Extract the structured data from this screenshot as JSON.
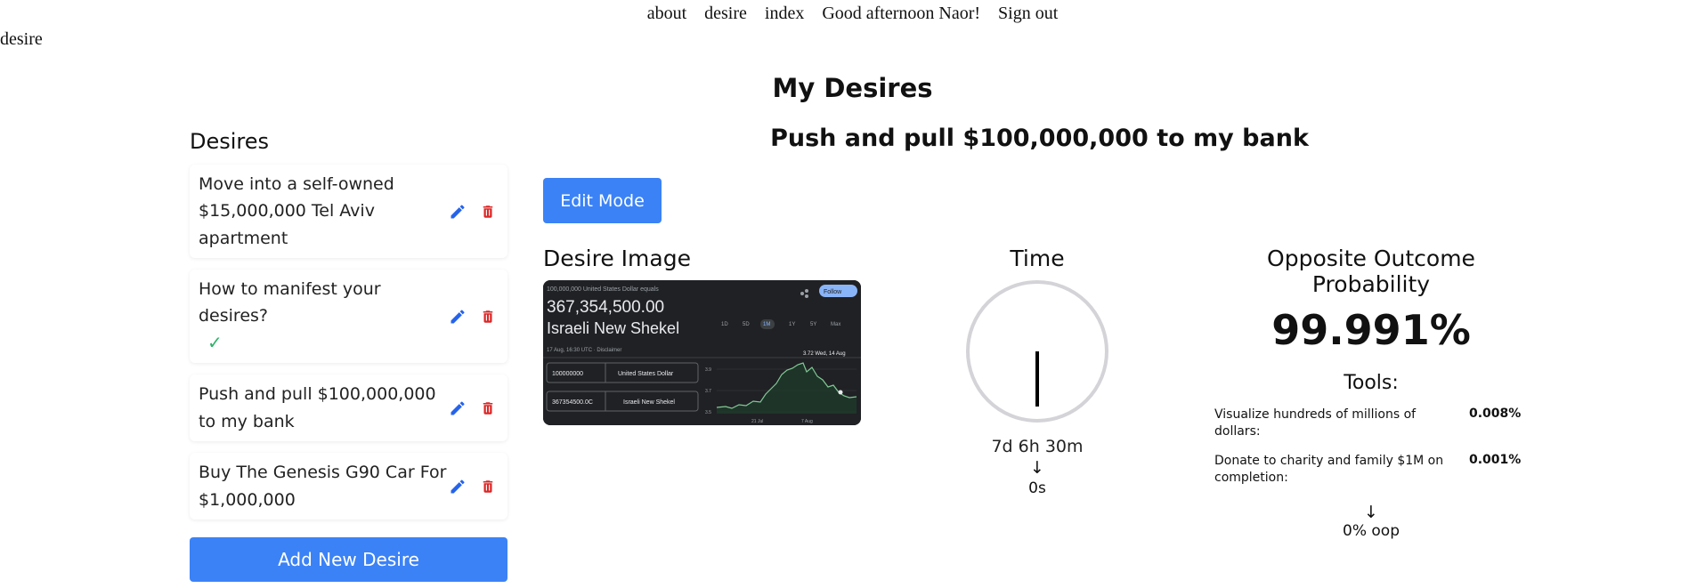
{
  "nav": {
    "links": [
      "about",
      "desire",
      "index"
    ],
    "greeting": "Good afternoon Naor!",
    "sign_out": "Sign out"
  },
  "route_label": "desire",
  "page_title": "My Desires",
  "sidebar": {
    "heading": "Desires",
    "items": [
      {
        "label": "Move into a self-owned $15,000,000 Tel Aviv apartment",
        "check": ""
      },
      {
        "label": "How to manifest your desires?",
        "check": "✓"
      },
      {
        "label": "Push and pull $100,000,000 to my bank",
        "check": ""
      },
      {
        "label": "Buy The Genesis G90 Car For $1,000,000",
        "check": ""
      }
    ],
    "add_button": "Add New Desire"
  },
  "desire": {
    "title": "Push and pull $100,000,000 to my bank",
    "edit_button": "Edit Mode",
    "image_heading": "Desire Image",
    "image": {
      "caption": "100,000,000 United States Dollar equals",
      "amount": "367,354,500.00",
      "currency": "Israeli New Shekel",
      "timestamp": "17 Aug, 16:30 UTC · Disclaimer",
      "follow": "Follow",
      "ranges": [
        "1D",
        "5D",
        "1M",
        "1Y",
        "5Y",
        "Max"
      ],
      "from_value": "100000000",
      "from_currency": "United States Dollar",
      "to_value": "367354500.0C",
      "to_currency": "Israeli New Shekel",
      "tooltip": "3.72  Wed, 14 Aug",
      "y_ticks": [
        "3.9",
        "3.7",
        "3.5"
      ],
      "x_ticks": [
        "21 Jul",
        "7 Aug"
      ]
    }
  },
  "time": {
    "heading": "Time",
    "remaining": "7d 6h 30m",
    "arrow": "↓",
    "seconds": "0s"
  },
  "probability": {
    "heading": "Opposite Outcome Probability",
    "value": "99.991%",
    "tools_heading": "Tools:",
    "tools": [
      {
        "label": "Visualize hundreds of millions of dollars:",
        "value": "0.008%"
      },
      {
        "label": "Donate to charity and family $1M on completion:",
        "value": "0.001%"
      }
    ],
    "arrow": "↓",
    "oop": "0% oop"
  },
  "colors": {
    "primary": "#3b82f6",
    "edit_icon": "#2563eb",
    "delete_icon": "#dc2626",
    "check": "#2fb36a"
  }
}
